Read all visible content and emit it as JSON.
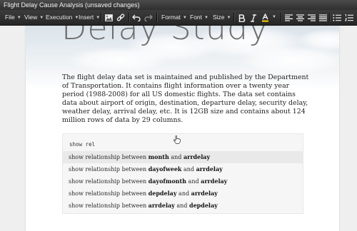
{
  "window": {
    "title": "Flight Delay Cause Analysis (unsaved changes)"
  },
  "toolbar": {
    "menus": [
      "File",
      "View",
      "Execution",
      "Insert"
    ],
    "format_menus": [
      "Format",
      "Font",
      "Size"
    ]
  },
  "hero": {
    "title": "Delay Study"
  },
  "body_text": "The flight delay data set is maintained and published by the Department of Transportation. It contains flight information over a twenty year period (1988-2008) for all US domestic flights. The data set contains data about airport of origin, destination, departure delay, security delay, weather delay, arrival delay, etc. It is 12GB size and contains about 124 million rows of data by 29 columns.",
  "cell": {
    "code": "show rel",
    "suggestions": [
      {
        "prefix": "show relationship between ",
        "a": "month",
        "mid": " and ",
        "b": "arrdelay"
      },
      {
        "prefix": "show relationship between ",
        "a": "dayofweek",
        "mid": " and ",
        "b": "arrdelay"
      },
      {
        "prefix": "show relationship between ",
        "a": "dayofmonth",
        "mid": " and ",
        "b": "arrdelay"
      },
      {
        "prefix": "show relationship between ",
        "a": "depdelay",
        "mid": " and ",
        "b": "arrdelay"
      },
      {
        "prefix": "show relationship between ",
        "a": "arrdelay",
        "mid": " and ",
        "b": "depdelay"
      }
    ],
    "selected_index": 0
  },
  "colors": {
    "toolbar_bg": "#2f2f2f",
    "page_bg": "#ffffff",
    "highlight": "#f0c800"
  }
}
